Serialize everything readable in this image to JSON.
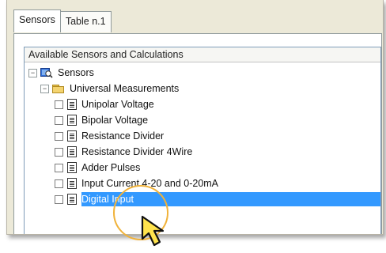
{
  "tabs": [
    {
      "label": "Sensors",
      "active": true
    },
    {
      "label": "Table n.1",
      "active": false
    }
  ],
  "group": {
    "title": "Available Sensors and Calculations"
  },
  "tree": {
    "root": {
      "label": "Sensors",
      "expander": "−"
    },
    "folder": {
      "label": "Universal Measurements",
      "expander": "−"
    },
    "items": [
      {
        "label": "Unipolar Voltage",
        "selected": false
      },
      {
        "label": "Bipolar Voltage",
        "selected": false
      },
      {
        "label": "Resistance Divider",
        "selected": false
      },
      {
        "label": "Resistance Divider 4Wire",
        "selected": false
      },
      {
        "label": "Adder Pulses",
        "selected": false
      },
      {
        "label": "Input Current 4-20 and 0-20mA",
        "selected": false
      },
      {
        "label": "Digital Input",
        "selected": true
      }
    ]
  },
  "colors": {
    "selection": "#3399ff",
    "highlight_circle": "#f0b23a",
    "cursor_fill": "#ffe34d"
  },
  "icons": {
    "root": "sensors-icon",
    "folder": "folder-icon",
    "item": "document-icon",
    "pointer": "arrow-cursor-icon"
  }
}
